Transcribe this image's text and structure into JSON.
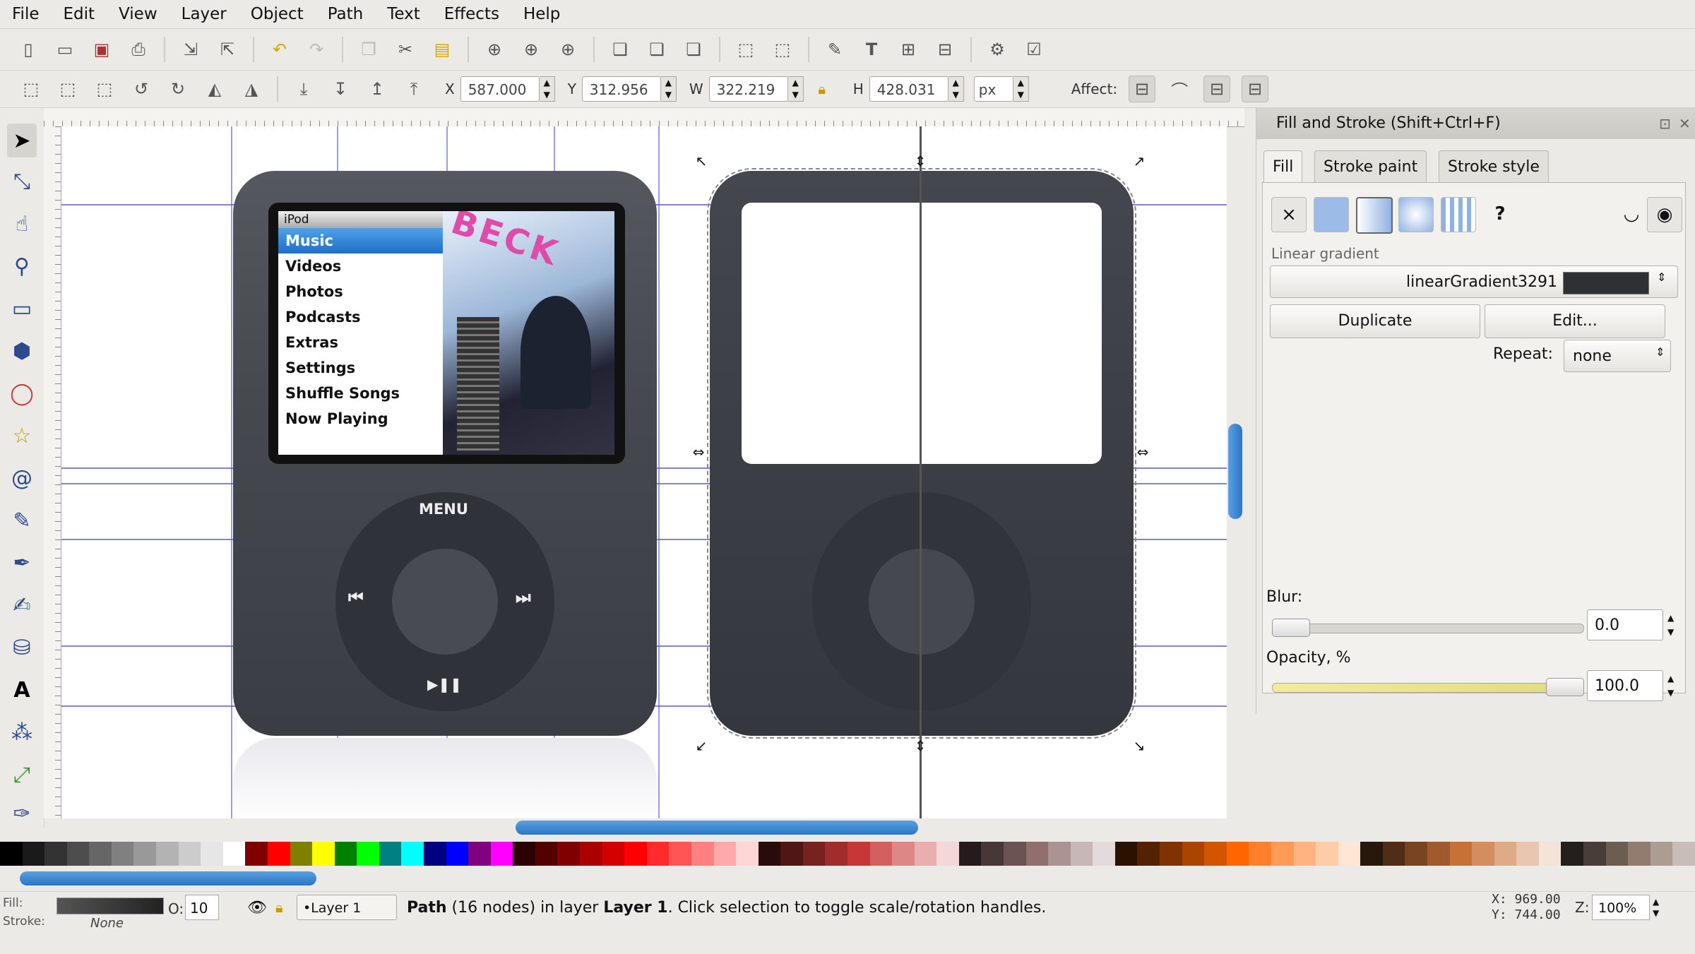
{
  "menu": [
    "File",
    "Edit",
    "View",
    "Layer",
    "Object",
    "Path",
    "Text",
    "Effects",
    "Help"
  ],
  "control_bar": {
    "x_label": "X",
    "x_value": "587.000",
    "y_label": "Y",
    "y_value": "312.956",
    "w_label": "W",
    "w_value": "322.219",
    "h_label": "H",
    "h_value": "428.031",
    "unit": "px",
    "affect_label": "Affect:"
  },
  "ipod": {
    "title": "iPod",
    "menu_items": [
      "Music",
      "Videos",
      "Photos",
      "Podcasts",
      "Extras",
      "Settings",
      "Shuffle Songs",
      "Now Playing"
    ],
    "selected_item": "Music",
    "album_text": "BECK",
    "wheel_menu": "MENU",
    "wheel_prev": "⏮",
    "wheel_next": "⏭",
    "wheel_play": "▶❚❚"
  },
  "panel": {
    "title": "Fill and Stroke (Shift+Ctrl+F)",
    "tabs": [
      "Fill",
      "Stroke paint",
      "Stroke style"
    ],
    "active_tab": "Fill",
    "section_label": "Linear gradient",
    "gradient_name": "linearGradient3291",
    "duplicate_label": "Duplicate",
    "edit_label": "Edit...",
    "repeat_label": "Repeat:",
    "repeat_value": "none",
    "blur_label": "Blur:",
    "blur_value": "0.0",
    "opacity_label": "Opacity, %",
    "opacity_value": "100.0",
    "paint_types": [
      "×",
      "",
      "",
      "",
      "",
      "?"
    ]
  },
  "status": {
    "fill_label": "Fill:",
    "stroke_label": "Stroke:",
    "stroke_value": "None",
    "opacity_label": "O:",
    "opacity_value": "10",
    "layer": "•Layer 1",
    "message_prefix": "Path",
    "message_middle": " (16 nodes) in layer ",
    "message_layer": "Layer 1",
    "message_suffix": ". Click selection to toggle scale/rotation handles.",
    "x_coord": "X:  969.00",
    "y_coord": "Y:  744.00",
    "zoom_label": "Z:",
    "zoom_value": "100%"
  },
  "colors": {
    "accent": "#2a76c6",
    "selected_menu": "#1f6fc8",
    "ipod_body": "#464950",
    "gradient_swatch": "#2e3034"
  },
  "palette": [
    "#000000",
    "#1a1a1a",
    "#333333",
    "#4d4d4d",
    "#666666",
    "#808080",
    "#999999",
    "#b3b3b3",
    "#cccccc",
    "#e6e6e6",
    "#ffffff",
    "#800000",
    "#ff0000",
    "#808000",
    "#ffff00",
    "#008000",
    "#00ff00",
    "#008080",
    "#00ffff",
    "#000080",
    "#0000ff",
    "#800080",
    "#ff00ff",
    "#2b0000",
    "#550000",
    "#800000",
    "#aa0000",
    "#d40000",
    "#ff0000",
    "#ff2a2a",
    "#ff5555",
    "#ff8080",
    "#ffaaaa",
    "#ffd5d5",
    "#280b0b",
    "#501616",
    "#782121",
    "#a02c2c",
    "#c83737",
    "#d35f5f",
    "#de8787",
    "#e9afaf",
    "#f4d7d7",
    "#241c1c",
    "#483737",
    "#6c5353",
    "#916f6f",
    "#ac9393",
    "#c8b7b7",
    "#e3dbdb",
    "#2b1100",
    "#552200",
    "#803300",
    "#aa4400",
    "#d45500",
    "#ff6600",
    "#ff7f2a",
    "#ff9955",
    "#ffb380",
    "#ffccaa",
    "#ffe6d5",
    "#28170b",
    "#502d16",
    "#784421",
    "#a05a2c",
    "#c87137",
    "#d38d5f",
    "#deaa87",
    "#e9c6af",
    "#f4e3d7",
    "#241f1c",
    "#483e37",
    "#6c5d53",
    "#917c6f",
    "#ac9d93",
    "#c8beb7"
  ]
}
